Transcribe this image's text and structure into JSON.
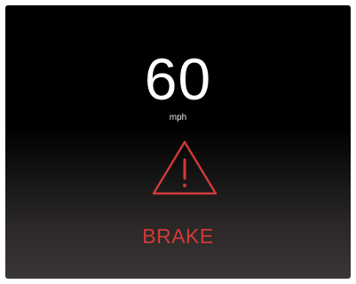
{
  "display": {
    "speed_value": "60",
    "speed_unit": "mph",
    "alert_label": "BRAKE",
    "warning_icon": "warning-triangle-icon"
  },
  "colors": {
    "text_primary": "#ffffff",
    "alert_red": "#d23a3a",
    "background_top": "#000000",
    "background_bottom": "#3a3736"
  }
}
